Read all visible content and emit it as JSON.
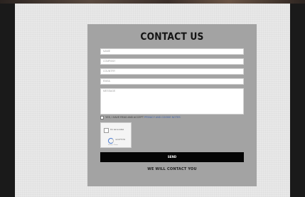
{
  "form": {
    "title": "CONTACT US",
    "fields": [
      {
        "placeholder": "NAME"
      },
      {
        "placeholder": "COMPANY"
      },
      {
        "placeholder": "COUNTRY"
      },
      {
        "placeholder": "EMAIL"
      },
      {
        "placeholder": "MESSAGE"
      }
    ],
    "consent_text": "YES, I HAVE READ AND ACCEPT",
    "consent_link": "PRIVACY AND COOKIE NOTES",
    "send_label": "SEND",
    "footer_note": "WE WILL CONTACT YOU"
  },
  "recaptcha": {
    "label": "I'm not a robot",
    "brand": "reCAPTCHA",
    "terms": "Privacy - Terms"
  },
  "colors": {
    "card_background": "#a3a3a3",
    "page_background": "#e8e8e8",
    "button_background": "#050505",
    "link": "#3b5fa8"
  }
}
